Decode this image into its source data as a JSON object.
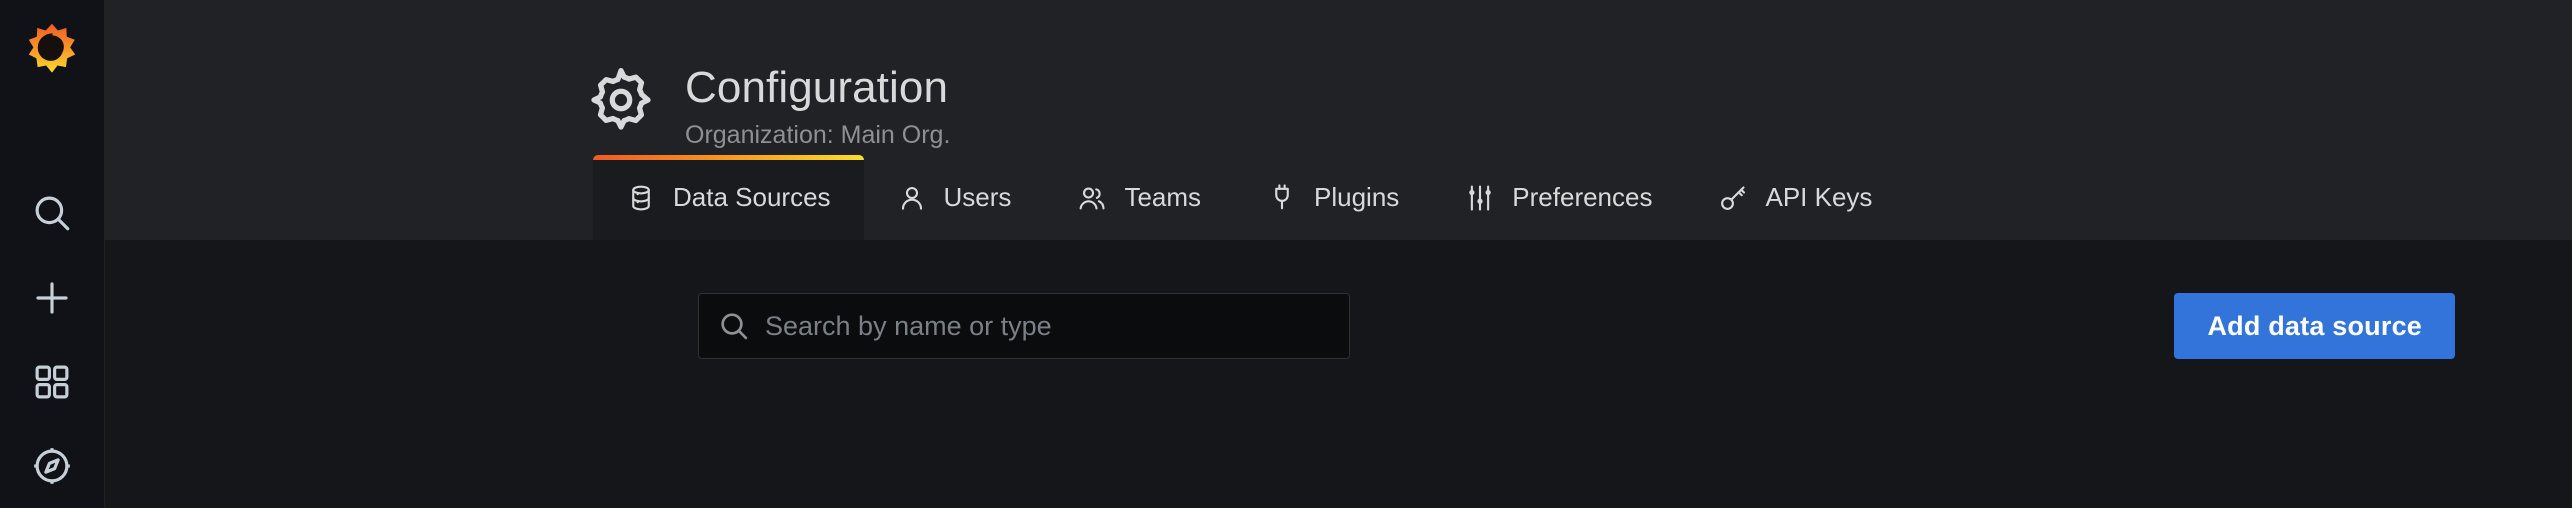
{
  "sidebar": {
    "brand": {
      "icon": "grafana-logo"
    },
    "items": [
      {
        "icon": "search-icon",
        "label": "Search"
      },
      {
        "icon": "plus-icon",
        "label": "Create"
      },
      {
        "icon": "dashboards-icon",
        "label": "Dashboards"
      },
      {
        "icon": "compass-icon",
        "label": "Explore"
      }
    ]
  },
  "header": {
    "icon": "gear-icon",
    "title": "Configuration",
    "subtitle": "Organization: Main Org."
  },
  "tabs": [
    {
      "label": "Data Sources",
      "icon": "database-icon",
      "active": true
    },
    {
      "label": "Users",
      "icon": "user-icon",
      "active": false
    },
    {
      "label": "Teams",
      "icon": "users-icon",
      "active": false
    },
    {
      "label": "Plugins",
      "icon": "plug-icon",
      "active": false
    },
    {
      "label": "Preferences",
      "icon": "sliders-icon",
      "active": false
    },
    {
      "label": "API Keys",
      "icon": "key-icon",
      "active": false
    }
  ],
  "content": {
    "search": {
      "placeholder": "Search by name or type",
      "value": "",
      "icon": "search-icon"
    },
    "add_button": {
      "label": "Add data source"
    }
  },
  "colors": {
    "sidebar_bg": "#111217",
    "header_bg": "#202226",
    "content_bg": "#141619",
    "active_tab_bg": "#1a1b1f",
    "accent_gradient_start": "#f05a28",
    "accent_gradient_end": "#fade2a",
    "primary_button": "#3274d9",
    "text_primary": "#d8d9da",
    "text_secondary": "#8e9094"
  }
}
